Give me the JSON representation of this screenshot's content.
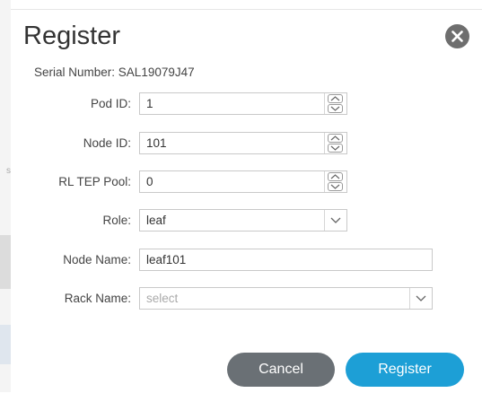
{
  "dialog": {
    "title": "Register",
    "serial_label": "Serial Number:",
    "serial_value": "SAL19079J47"
  },
  "fields": {
    "pod_id": {
      "label": "Pod ID:",
      "value": "1"
    },
    "node_id": {
      "label": "Node ID:",
      "value": "101"
    },
    "rl_tep_pool": {
      "label": "RL TEP Pool:",
      "value": "0"
    },
    "role": {
      "label": "Role:",
      "value": "leaf"
    },
    "node_name": {
      "label": "Node Name:",
      "value": "leaf101"
    },
    "rack_name": {
      "label": "Rack Name:",
      "placeholder": "select"
    }
  },
  "buttons": {
    "cancel": "Cancel",
    "register": "Register"
  },
  "background": {
    "mark": "s"
  },
  "icons": {
    "close": "close-icon",
    "stepper_up": "chevron-up-icon",
    "stepper_down": "chevron-down-icon",
    "dropdown": "chevron-down-icon"
  },
  "colors": {
    "accent": "#1d9fd6",
    "cancel": "#6a7075",
    "close": "#6e6e6e"
  }
}
